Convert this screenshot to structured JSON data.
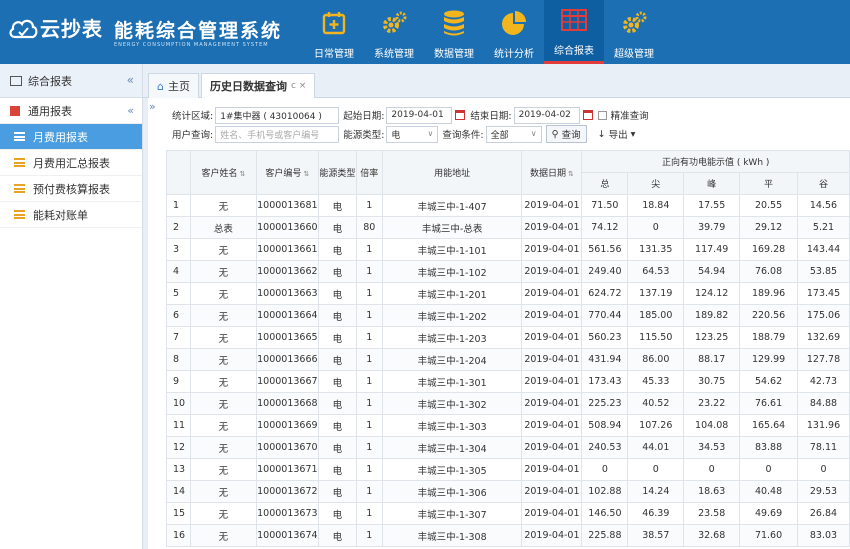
{
  "header": {
    "brand": "云抄表",
    "title": "能耗综合管理系统",
    "subtitle": "ENERGY CONSUMPTION MANAGEMENT SYSTEM",
    "nav": [
      {
        "label": "日常管理",
        "icon": "calendar-plus-icon"
      },
      {
        "label": "系统管理",
        "icon": "gears-icon"
      },
      {
        "label": "数据管理",
        "icon": "database-icon"
      },
      {
        "label": "统计分析",
        "icon": "pie-chart-icon"
      },
      {
        "label": "综合报表",
        "icon": "table-icon",
        "active": true
      },
      {
        "label": "超级管理",
        "icon": "gears-icon"
      }
    ]
  },
  "sidebar": {
    "title": "综合报表",
    "collapse": "«",
    "group": "通用报表",
    "items": [
      {
        "label": "月费用报表",
        "active": true
      },
      {
        "label": "月费用汇总报表"
      },
      {
        "label": "预付费核算报表"
      },
      {
        "label": "能耗对账单"
      }
    ]
  },
  "tabs": {
    "home": "主页",
    "current": "历史日数据查询",
    "close": "c ×"
  },
  "filters": {
    "area_label": "统计区域:",
    "area_value": "1#集中器 ( 43010064 )",
    "start_label": "起始日期:",
    "start_value": "2019-04-01",
    "end_label": "结束日期:",
    "end_value": "2019-04-02",
    "exact_label": "精准查询",
    "user_label": "用户查询:",
    "user_placeholder": "姓名、手机号或客户编号",
    "energy_label": "能源类型:",
    "energy_value": "电",
    "cond_label": "查询条件:",
    "cond_value": "全部",
    "query_btn": "查询",
    "export_btn": "导出"
  },
  "table": {
    "headers": {
      "name": "客户姓名",
      "code": "客户编号",
      "energy": "能源类型",
      "ratio": "倍率",
      "addr": "用能地址",
      "date": "数据日期",
      "group": "正向有功电能示值 ( kWh )",
      "total": "总",
      "sharp": "尖",
      "peak": "峰",
      "flat": "平",
      "valley": "谷"
    },
    "rows": [
      [
        "1",
        "无",
        "1000013681",
        "电",
        "1",
        "丰城三中-1-407",
        "2019-04-01",
        "71.50",
        "18.84",
        "17.55",
        "20.55",
        "14.56"
      ],
      [
        "2",
        "总表",
        "1000013660",
        "电",
        "80",
        "丰城三中-总表",
        "2019-04-01",
        "74.12",
        "0",
        "39.79",
        "29.12",
        "5.21"
      ],
      [
        "3",
        "无",
        "1000013661",
        "电",
        "1",
        "丰城三中-1-101",
        "2019-04-01",
        "561.56",
        "131.35",
        "117.49",
        "169.28",
        "143.44"
      ],
      [
        "4",
        "无",
        "1000013662",
        "电",
        "1",
        "丰城三中-1-102",
        "2019-04-01",
        "249.40",
        "64.53",
        "54.94",
        "76.08",
        "53.85"
      ],
      [
        "5",
        "无",
        "1000013663",
        "电",
        "1",
        "丰城三中-1-201",
        "2019-04-01",
        "624.72",
        "137.19",
        "124.12",
        "189.96",
        "173.45"
      ],
      [
        "6",
        "无",
        "1000013664",
        "电",
        "1",
        "丰城三中-1-202",
        "2019-04-01",
        "770.44",
        "185.00",
        "189.82",
        "220.56",
        "175.06"
      ],
      [
        "7",
        "无",
        "1000013665",
        "电",
        "1",
        "丰城三中-1-203",
        "2019-04-01",
        "560.23",
        "115.50",
        "123.25",
        "188.79",
        "132.69"
      ],
      [
        "8",
        "无",
        "1000013666",
        "电",
        "1",
        "丰城三中-1-204",
        "2019-04-01",
        "431.94",
        "86.00",
        "88.17",
        "129.99",
        "127.78"
      ],
      [
        "9",
        "无",
        "1000013667",
        "电",
        "1",
        "丰城三中-1-301",
        "2019-04-01",
        "173.43",
        "45.33",
        "30.75",
        "54.62",
        "42.73"
      ],
      [
        "10",
        "无",
        "1000013668",
        "电",
        "1",
        "丰城三中-1-302",
        "2019-04-01",
        "225.23",
        "40.52",
        "23.22",
        "76.61",
        "84.88"
      ],
      [
        "11",
        "无",
        "1000013669",
        "电",
        "1",
        "丰城三中-1-303",
        "2019-04-01",
        "508.94",
        "107.26",
        "104.08",
        "165.64",
        "131.96"
      ],
      [
        "12",
        "无",
        "1000013670",
        "电",
        "1",
        "丰城三中-1-304",
        "2019-04-01",
        "240.53",
        "44.01",
        "34.53",
        "83.88",
        "78.11"
      ],
      [
        "13",
        "无",
        "1000013671",
        "电",
        "1",
        "丰城三中-1-305",
        "2019-04-01",
        "0",
        "0",
        "0",
        "0",
        "0"
      ],
      [
        "14",
        "无",
        "1000013672",
        "电",
        "1",
        "丰城三中-1-306",
        "2019-04-01",
        "102.88",
        "14.24",
        "18.63",
        "40.48",
        "29.53"
      ],
      [
        "15",
        "无",
        "1000013673",
        "电",
        "1",
        "丰城三中-1-307",
        "2019-04-01",
        "146.50",
        "46.39",
        "23.58",
        "49.69",
        "26.84"
      ],
      [
        "16",
        "无",
        "1000013674",
        "电",
        "1",
        "丰城三中-1-308",
        "2019-04-01",
        "225.88",
        "38.57",
        "32.68",
        "71.60",
        "83.03"
      ]
    ]
  },
  "colors": {
    "header_bg": "#1d6fb3",
    "nav_active_underline": "#e23b3b",
    "sidebar_active": "#4a9de0",
    "icon_gold": "#f2b51d"
  }
}
